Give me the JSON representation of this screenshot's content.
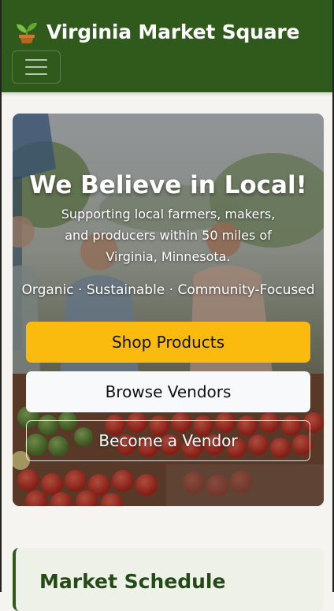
{
  "navbar": {
    "brand": "Virginia Market Square",
    "brand_icon": "seedling-icon",
    "toggle_icon": "hamburger-menu-icon",
    "color": "#2f5a1b"
  },
  "hero": {
    "title": "We Believe in Local!",
    "lead": "Supporting local farmers, makers, and producers within 50 miles of Virginia, Minnesota.",
    "tagline": "Organic · Sustainable · Community-Focused",
    "buttons": {
      "shop": "Shop Products",
      "browse": "Browse Vendors",
      "vendor": "Become a Vendor"
    },
    "accent": "#fbbb0e"
  },
  "schedule": {
    "title": "Market Schedule"
  }
}
